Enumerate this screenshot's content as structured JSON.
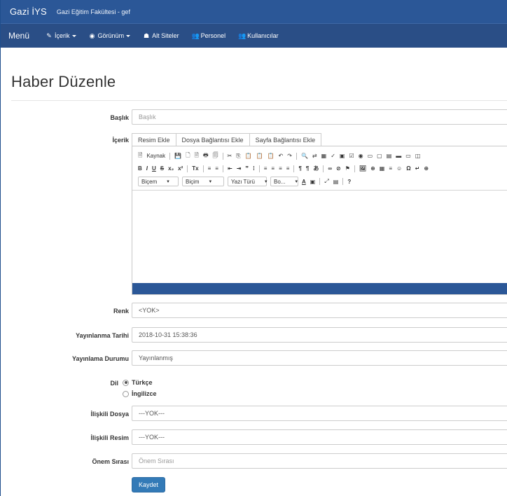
{
  "header": {
    "brand": "Gazi İYS",
    "site_name": "Gazi Eğitim Fakültesi - gef"
  },
  "nav": {
    "menu_label": "Menü",
    "items": [
      {
        "icon": "edit-icon",
        "glyph": "✎",
        "label": "İçerik",
        "dropdown": true
      },
      {
        "icon": "eye-icon",
        "glyph": "◉",
        "label": "Görünüm",
        "dropdown": true
      },
      {
        "icon": "sitemap-icon",
        "glyph": "☗",
        "label": "Alt Siteler",
        "dropdown": false
      },
      {
        "icon": "users-icon",
        "glyph": "👥",
        "label": "Personel",
        "dropdown": false
      },
      {
        "icon": "users-icon",
        "glyph": "👥",
        "label": "Kullanıcılar",
        "dropdown": false
      }
    ]
  },
  "page": {
    "title": "Haber Düzenle"
  },
  "form": {
    "baslik_label": "Başlık",
    "baslik_placeholder": "Başlık",
    "icerik_label": "İçerik",
    "tabs": [
      "Resim Ekle",
      "Dosya Bağlantısı Ekle",
      "Sayfa Bağlantısı Ekle"
    ],
    "editor": {
      "source_label": "Kaynak",
      "row1_glyphs": [
        "💾",
        "🗋",
        "🗎",
        "🖶",
        "🗐",
        "✂",
        "⎘",
        "📋",
        "📋",
        "📋",
        "↶",
        "↷",
        "🔍",
        "⇄",
        "▦",
        "✓"
      ],
      "row2_glyphs": [
        "B",
        "I",
        "U",
        "S",
        "x₂",
        "x²",
        "Tx",
        "≡",
        "≡",
        "⇤",
        "⇥",
        "❞",
        "⁞",
        "≡",
        "≡",
        "≡",
        "≡",
        "¶",
        "¶",
        "あ",
        "∞",
        "⊘",
        "⚑",
        "🖼",
        "⊕",
        "▦",
        "≡",
        "☺",
        "Ω",
        "↵",
        "⊕"
      ],
      "dropdowns": [
        "Biçem",
        "Biçim",
        "Yazı Türü",
        "Bo..."
      ],
      "row3_glyphs": [
        "A",
        "▣",
        "⤢",
        "▤",
        "?"
      ]
    },
    "renk_label": "Renk",
    "renk_value": "<YOK>",
    "tarih_label": "Yayınlanma Tarihi",
    "tarih_value": "2018-10-31 15:38:36",
    "durum_label": "Yayınlama Durumu",
    "durum_value": "Yayınlanmış",
    "dil_label": "Dil",
    "dil_options": [
      {
        "label": "Türkçe",
        "selected": true
      },
      {
        "label": "İngilizce",
        "selected": false
      }
    ],
    "dosya_label": "İlişkili Dosya",
    "dosya_value": "---YOK---",
    "resim_label": "İlişkili Resim",
    "resim_value": "---YOK---",
    "onem_label": "Önem Sırası",
    "onem_placeholder": "Önem Sırası",
    "submit_label": "Kaydet"
  },
  "colors": {
    "topbar": "#2b5797",
    "navbar": "#2a4e86",
    "primary_button": "#337ab7"
  }
}
